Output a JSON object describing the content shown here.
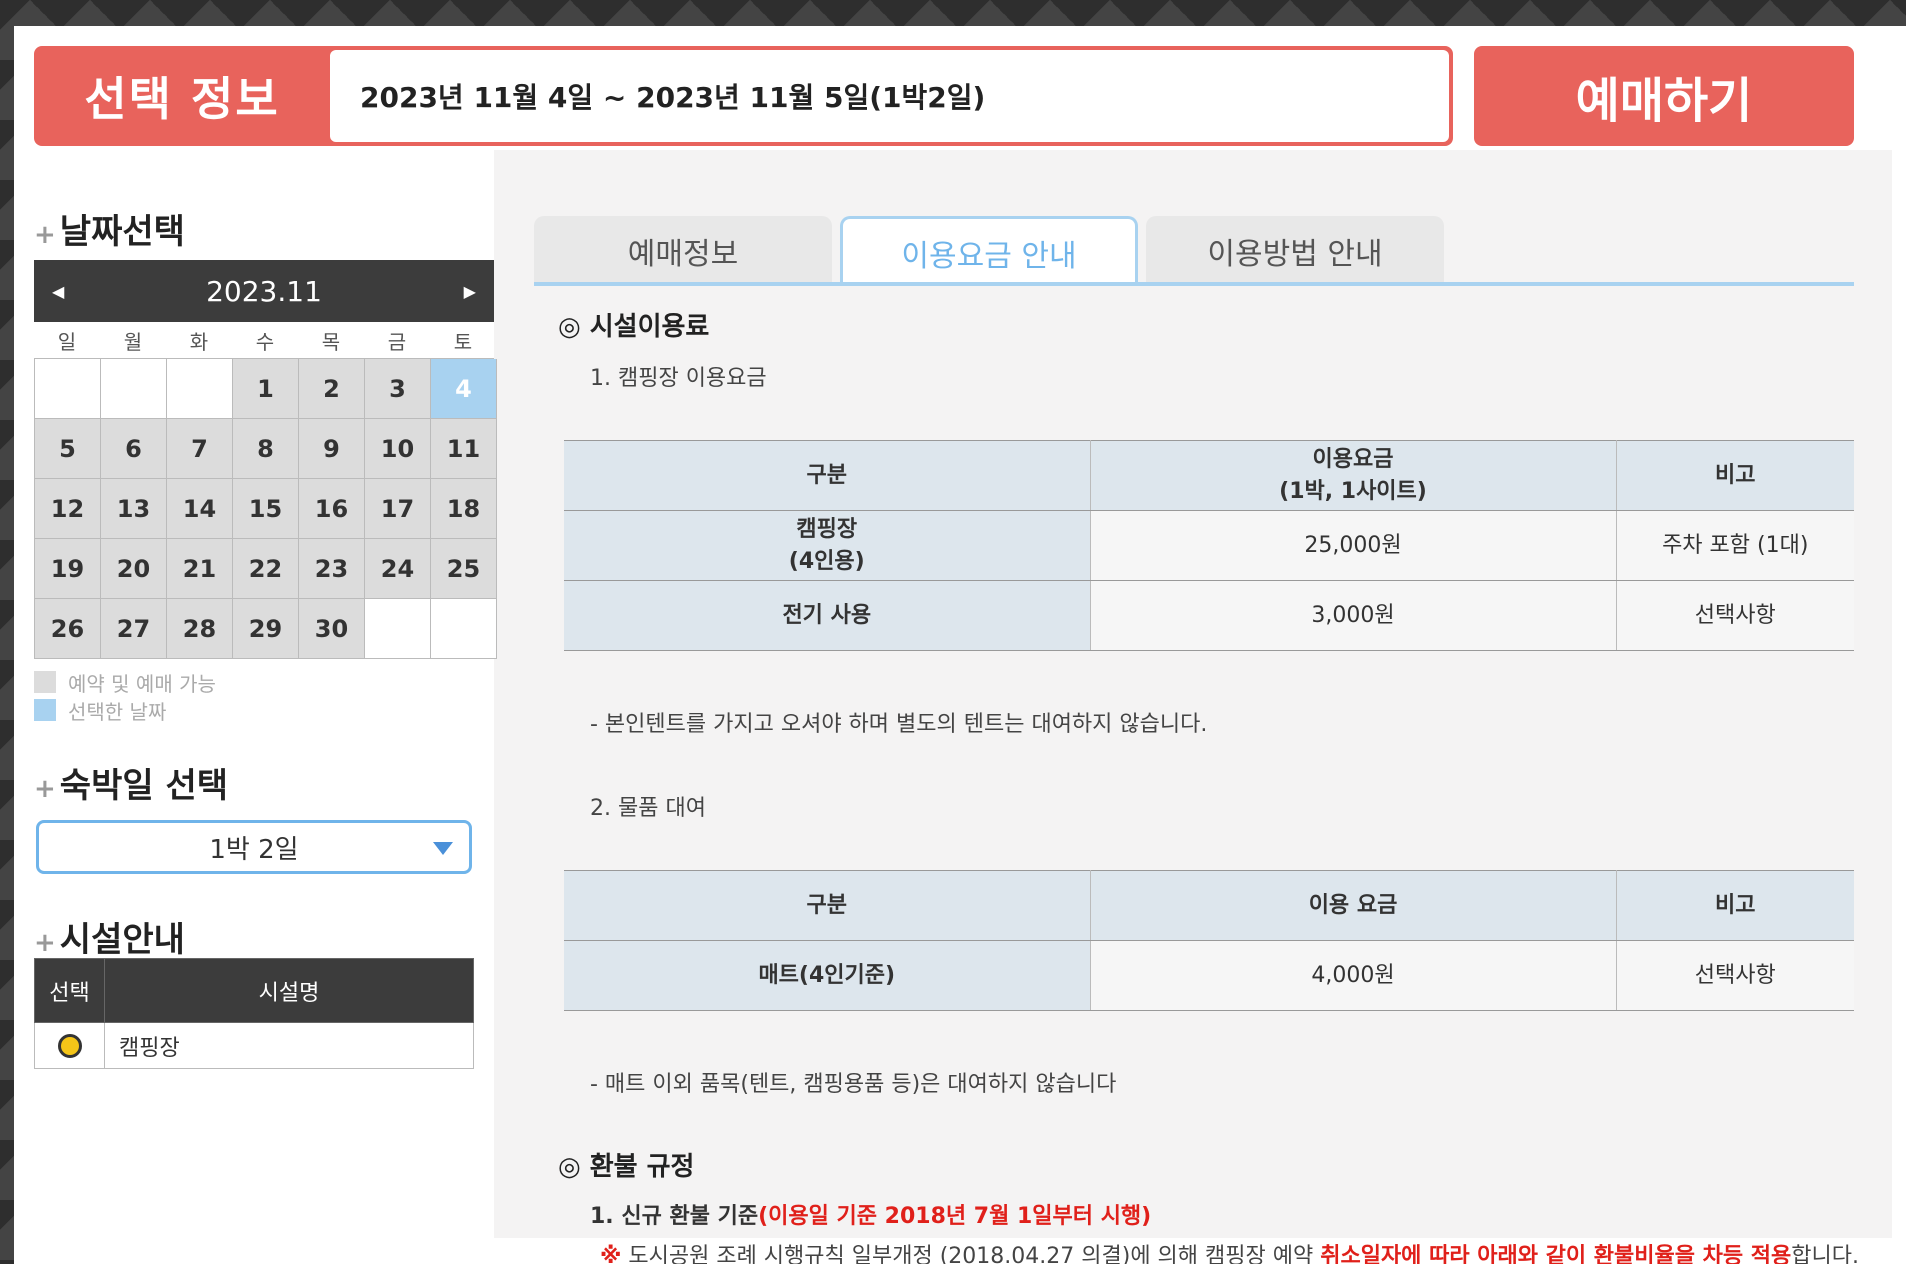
{
  "header": {
    "selection_label": "선택 정보",
    "selection_value": "2023년 11월 4일 ~ 2023년 11월 5일(1박2일)",
    "book_button": "예매하기"
  },
  "left": {
    "date_heading": "날짜선택",
    "calendar": {
      "month": "2023.11",
      "weekdays": [
        "일",
        "월",
        "화",
        "수",
        "목",
        "금",
        "토"
      ],
      "days": [
        "",
        "",
        "",
        "1",
        "2",
        "3",
        "4",
        "5",
        "6",
        "7",
        "8",
        "9",
        "10",
        "11",
        "12",
        "13",
        "14",
        "15",
        "16",
        "17",
        "18",
        "19",
        "20",
        "21",
        "22",
        "23",
        "24",
        "25",
        "26",
        "27",
        "28",
        "29",
        "30",
        "",
        ""
      ],
      "selected_day": "4"
    },
    "legend": {
      "available": "예약 및 예매 가능",
      "selected": "선택한 날짜"
    },
    "nights_heading": "숙박일 선택",
    "nights_value": "1박 2일",
    "facility_heading": "시설안내",
    "facility_table": {
      "col_select": "선택",
      "col_name": "시설명",
      "row_name": "캠핑장"
    }
  },
  "tabs": [
    "예매정보",
    "이용요금 안내",
    "이용방법 안내"
  ],
  "content": {
    "fee_heading": "◎ 시설이용료",
    "section1_title": "1. 캠핑장 이용요금",
    "table1": {
      "headers": [
        "구분",
        "이용요금\n(1박, 1사이트)",
        "비고"
      ],
      "rows": [
        [
          "캠핑장\n(4인용)",
          "25,000원",
          "주차 포함 (1대)"
        ],
        [
          "전기 사용",
          "3,000원",
          "선택사항"
        ]
      ]
    },
    "note1": "- 본인텐트를 가지고 오셔야 하며 별도의 텐트는 대여하지 않습니다.",
    "section2_title": "2. 물품 대여",
    "table2": {
      "headers": [
        "구분",
        "이용 요금",
        "비고"
      ],
      "rows": [
        [
          "매트(4인기준)",
          "4,000원",
          "선택사항"
        ]
      ]
    },
    "note2": "- 매트 이외 품목(텐트, 캠핑용품 등)은 대여하지 않습니다",
    "refund_heading": "◎ 환불 규정",
    "refund_item_prefix": "1. 신규 환불 기준",
    "refund_item_red": "(이용일 기준 2018년 7월 1일부터 시행)",
    "refund_note_mark": "※",
    "refund_note_text": " 도시공원 조례 시행규칙 일부개정 (2018.04.27 의결)에 의해 캠핑장 예약 ",
    "refund_note_red": "취소일자에 따라 아래와 같이 환불비율을 차등 적용",
    "refund_note_end": "합니다."
  },
  "colors": {
    "accent": "#e8635c",
    "selected_day": "#a8d2f0",
    "tab_active": "#6fb4ea",
    "table_header": "#dde6ed",
    "warning": "#e0201a"
  }
}
